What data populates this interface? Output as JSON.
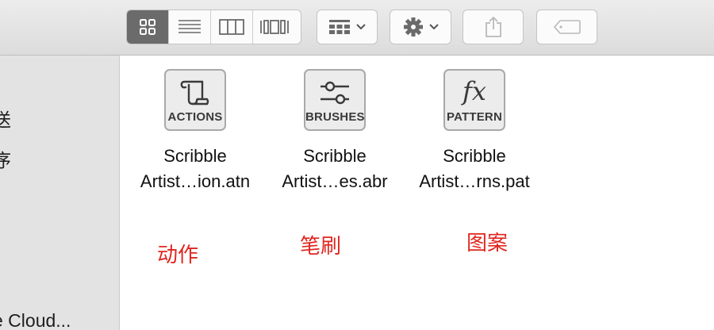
{
  "toolbar": {
    "view_modes": [
      "icon-view",
      "list-view",
      "column-view",
      "gallery-view"
    ],
    "active_view": "icon-view",
    "group_button": "group-icon",
    "action_button": "gear-icon",
    "share_button": "share-icon",
    "tag_button": "tag-icon"
  },
  "sidebar": {
    "items": [
      "送",
      "序",
      "e Cloud..."
    ]
  },
  "files": [
    {
      "badge": "ACTIONS",
      "name_line1": "Scribble",
      "name_line2": "Artist…ion.atn",
      "icon": "scroll-icon"
    },
    {
      "badge": "BRUSHES",
      "name_line1": "Scribble",
      "name_line2": "Artist…es.abr",
      "icon": "sliders-icon"
    },
    {
      "badge": "PATTERN",
      "name_line1": "Scribble",
      "name_line2": "Artist…rns.pat",
      "icon": "fx-icon",
      "glyph_text": "fx"
    }
  ],
  "annotations": [
    "动作",
    "笔刷",
    "图案"
  ],
  "colors": {
    "annotation": "#e0261f",
    "active_segment": "#6b6b6b"
  }
}
